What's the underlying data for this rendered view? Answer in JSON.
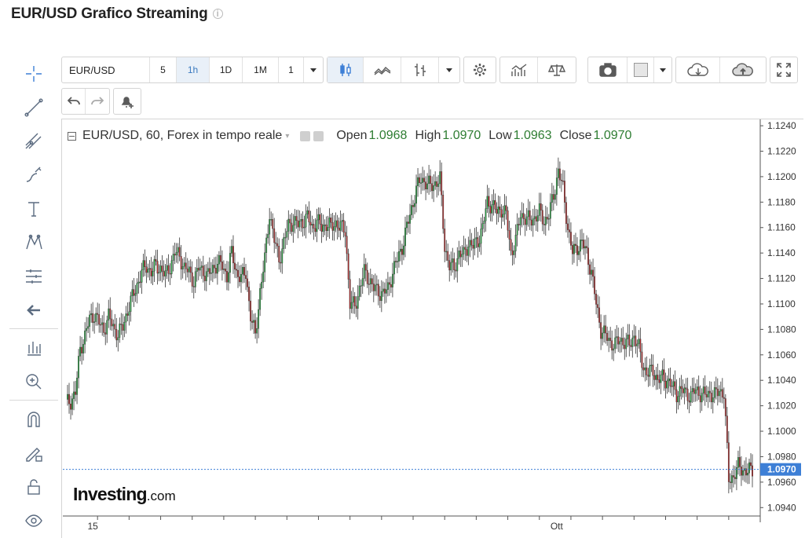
{
  "page": {
    "title": "EUR/USD Grafico Streaming",
    "info_icon": "info-icon"
  },
  "toolbar": {
    "symbol": "EUR/USD",
    "intervals": [
      "5",
      "1h",
      "1D",
      "1M",
      "1"
    ],
    "active_interval": "1h"
  },
  "left_tools": [
    "crosshair-icon",
    "trend-line-icon",
    "fib-icon",
    "brush-icon",
    "text-icon",
    "pattern-icon",
    "gann-icon",
    "back-arrow-icon",
    "chart-types-icon",
    "zoom-in-icon",
    "magnet-icon",
    "lock-pencil-icon",
    "lock-icon",
    "eye-icon"
  ],
  "legend": {
    "title": "EUR/USD, 60, Forex in tempo reale",
    "open_label": "Open",
    "open": "1.0968",
    "high_label": "High",
    "high": "1.0970",
    "low_label": "Low",
    "low": "1.0963",
    "close_label": "Close",
    "close": "1.0970"
  },
  "colors": {
    "up": "#26a341",
    "down": "#b22a2a",
    "last_price_bg": "#3d7fd6",
    "price_line": "#3d7fd6"
  },
  "logo": {
    "main": "Investing",
    "suffix": ".com"
  },
  "chart_data": {
    "type": "candlestick",
    "symbol": "EUR/USD",
    "interval": "60",
    "y_ticks": [
      "1.1240",
      "1.1220",
      "1.1200",
      "1.1180",
      "1.1160",
      "1.1140",
      "1.1120",
      "1.1100",
      "1.1080",
      "1.1060",
      "1.1040",
      "1.1020",
      "1.1000",
      "1.0980",
      "1.0960",
      "1.0940"
    ],
    "ylim": [
      1.0934,
      1.1245
    ],
    "x_tick_labels": [
      "15",
      "Ott"
    ],
    "last_price": "1.0970",
    "grid": false,
    "close_path": [
      [
        0,
        1.1022
      ],
      [
        3,
        1.1024
      ],
      [
        6,
        1.103
      ],
      [
        9,
        1.1065
      ],
      [
        12,
        1.1075
      ],
      [
        15,
        1.1088
      ],
      [
        18,
        1.1092
      ],
      [
        21,
        1.1085
      ],
      [
        24,
        1.108
      ],
      [
        27,
        1.109
      ],
      [
        30,
        1.1082
      ],
      [
        33,
        1.1076
      ],
      [
        36,
        1.1082
      ],
      [
        39,
        1.1095
      ],
      [
        42,
        1.1105
      ],
      [
        45,
        1.1115
      ],
      [
        48,
        1.1125
      ],
      [
        51,
        1.113
      ],
      [
        54,
        1.1125
      ],
      [
        57,
        1.113
      ],
      [
        60,
        1.1128
      ],
      [
        63,
        1.1122
      ],
      [
        66,
        1.113
      ],
      [
        69,
        1.114
      ],
      [
        72,
        1.1138
      ],
      [
        75,
        1.1128
      ],
      [
        78,
        1.1125
      ],
      [
        81,
        1.1118
      ],
      [
        84,
        1.1128
      ],
      [
        87,
        1.1126
      ],
      [
        90,
        1.1122
      ],
      [
        93,
        1.1128
      ],
      [
        96,
        1.1132
      ],
      [
        99,
        1.113
      ],
      [
        102,
        1.1122
      ],
      [
        105,
        1.114
      ],
      [
        108,
        1.1125
      ],
      [
        111,
        1.112
      ],
      [
        114,
        1.1125
      ],
      [
        117,
        1.109
      ],
      [
        120,
        1.1075
      ],
      [
        123,
        1.111
      ],
      [
        126,
        1.1135
      ],
      [
        129,
        1.1172
      ],
      [
        132,
        1.115
      ],
      [
        135,
        1.1135
      ],
      [
        138,
        1.1148
      ],
      [
        141,
        1.1162
      ],
      [
        144,
        1.1165
      ],
      [
        147,
        1.1162
      ],
      [
        150,
        1.1165
      ],
      [
        153,
        1.1168
      ],
      [
        156,
        1.116
      ],
      [
        159,
        1.1165
      ],
      [
        162,
        1.116
      ],
      [
        165,
        1.1163
      ],
      [
        168,
        1.116
      ],
      [
        171,
        1.1164
      ],
      [
        174,
        1.116
      ],
      [
        177,
        1.1158
      ],
      [
        180,
        1.11
      ],
      [
        183,
        1.1098
      ],
      [
        186,
        1.1112
      ],
      [
        189,
        1.1125
      ],
      [
        192,
        1.112
      ],
      [
        195,
        1.1112
      ],
      [
        198,
        1.111
      ],
      [
        201,
        1.1108
      ],
      [
        204,
        1.1112
      ],
      [
        207,
        1.1125
      ],
      [
        210,
        1.1135
      ],
      [
        213,
        1.1145
      ],
      [
        216,
        1.116
      ],
      [
        219,
        1.1175
      ],
      [
        222,
        1.119
      ],
      [
        225,
        1.1198
      ],
      [
        228,
        1.1196
      ],
      [
        231,
        1.1192
      ],
      [
        234,
        1.1195
      ],
      [
        237,
        1.1198
      ],
      [
        240,
        1.1145
      ],
      [
        243,
        1.113
      ],
      [
        246,
        1.1128
      ],
      [
        249,
        1.114
      ],
      [
        252,
        1.1138
      ],
      [
        255,
        1.1148
      ],
      [
        258,
        1.1145
      ],
      [
        261,
        1.115
      ],
      [
        264,
        1.116
      ],
      [
        267,
        1.118
      ],
      [
        270,
        1.1178
      ],
      [
        273,
        1.1172
      ],
      [
        276,
        1.1175
      ],
      [
        279,
        1.117
      ],
      [
        282,
        1.114
      ],
      [
        285,
        1.115
      ],
      [
        288,
        1.117
      ],
      [
        291,
        1.1168
      ],
      [
        294,
        1.1165
      ],
      [
        297,
        1.1168
      ],
      [
        300,
        1.1172
      ],
      [
        303,
        1.1165
      ],
      [
        306,
        1.117
      ],
      [
        309,
        1.1185
      ],
      [
        312,
        1.1205
      ],
      [
        315,
        1.119
      ],
      [
        318,
        1.116
      ],
      [
        321,
        1.114
      ],
      [
        324,
        1.1145
      ],
      [
        327,
        1.1148
      ],
      [
        330,
        1.114
      ],
      [
        333,
        1.1125
      ],
      [
        336,
        1.11
      ],
      [
        339,
        1.108
      ],
      [
        342,
        1.1075
      ],
      [
        345,
        1.107
      ],
      [
        348,
        1.1068
      ],
      [
        351,
        1.1072
      ],
      [
        354,
        1.107
      ],
      [
        357,
        1.1068
      ],
      [
        360,
        1.1075
      ],
      [
        363,
        1.1065
      ],
      [
        366,
        1.105
      ],
      [
        369,
        1.1045
      ],
      [
        372,
        1.1048
      ],
      [
        375,
        1.104
      ],
      [
        378,
        1.1042
      ],
      [
        381,
        1.104
      ],
      [
        384,
        1.1035
      ],
      [
        387,
        1.103
      ],
      [
        390,
        1.1032
      ],
      [
        393,
        1.103
      ],
      [
        396,
        1.1028
      ],
      [
        399,
        1.1032
      ],
      [
        402,
        1.103
      ],
      [
        405,
        1.1028
      ],
      [
        408,
        1.103
      ],
      [
        411,
        1.1028
      ],
      [
        414,
        1.1032
      ],
      [
        417,
        1.103
      ],
      [
        420,
        1.0962
      ],
      [
        423,
        1.0965
      ],
      [
        426,
        1.0972
      ],
      [
        429,
        1.097
      ],
      [
        432,
        1.0968
      ],
      [
        435,
        1.097
      ]
    ]
  }
}
